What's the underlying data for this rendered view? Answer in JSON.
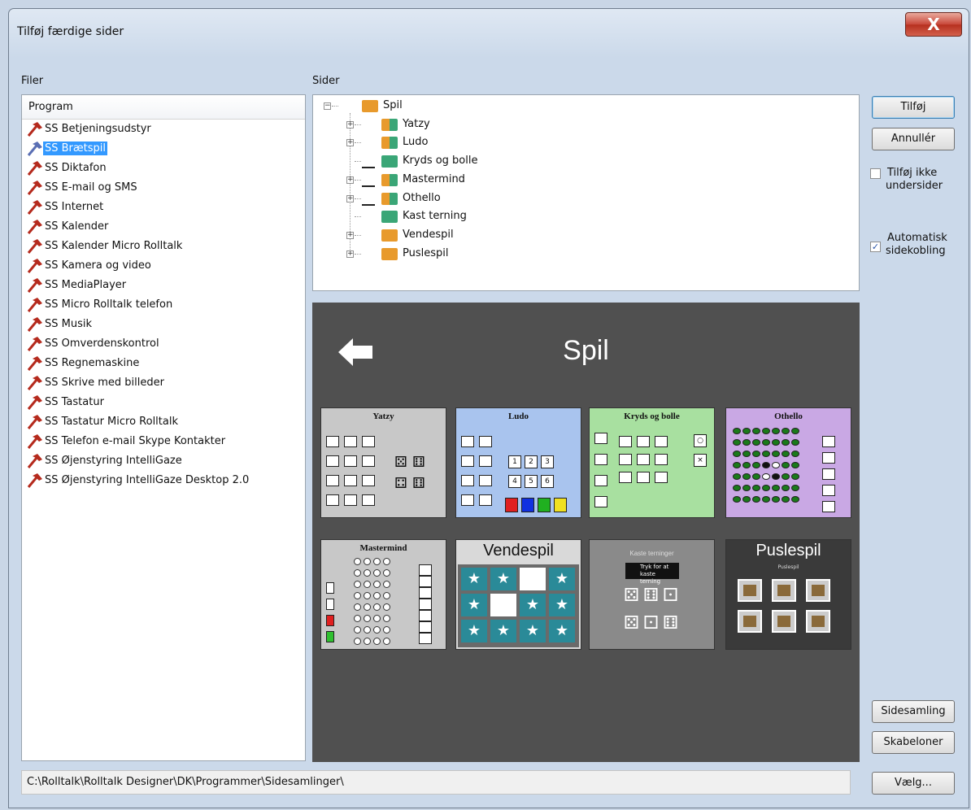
{
  "window": {
    "title": "Tilføj færdige sider",
    "close_glyph": "X"
  },
  "files": {
    "label": "Filer",
    "column_header": "Program",
    "items": [
      {
        "label": "SS Betjeningsudstyr",
        "selected": false
      },
      {
        "label": "SS Brætspil",
        "selected": true
      },
      {
        "label": "SS Diktafon",
        "selected": false
      },
      {
        "label": "SS E-mail og SMS",
        "selected": false
      },
      {
        "label": "SS Internet",
        "selected": false
      },
      {
        "label": "SS Kalender",
        "selected": false
      },
      {
        "label": "SS Kalender Micro Rolltalk",
        "selected": false
      },
      {
        "label": "SS Kamera og video",
        "selected": false
      },
      {
        "label": "SS MediaPlayer",
        "selected": false
      },
      {
        "label": "SS Micro Rolltalk telefon",
        "selected": false
      },
      {
        "label": "SS Musik",
        "selected": false
      },
      {
        "label": "SS Omverdenskontrol",
        "selected": false
      },
      {
        "label": "SS Regnemaskine",
        "selected": false
      },
      {
        "label": "SS Skrive med billeder",
        "selected": false
      },
      {
        "label": "SS Tastatur",
        "selected": false
      },
      {
        "label": "SS Tastatur Micro Rolltalk",
        "selected": false
      },
      {
        "label": "SS Telefon e-mail Skype Kontakter",
        "selected": false
      },
      {
        "label": "SS Øjenstyring IntelliGaze",
        "selected": false
      },
      {
        "label": "SS Øjenstyring IntelliGaze Desktop 2.0",
        "selected": false
      }
    ]
  },
  "pages": {
    "label": "Sider",
    "tree": {
      "root": "Spil",
      "children": [
        {
          "label": "Yatzy",
          "expandable": true
        },
        {
          "label": "Ludo",
          "expandable": true
        },
        {
          "label": "Kryds og bolle",
          "expandable": false
        },
        {
          "label": "Mastermind",
          "expandable": true
        },
        {
          "label": "Othello",
          "expandable": true
        },
        {
          "label": "Kast terning",
          "expandable": false
        },
        {
          "label": "Vendespil",
          "expandable": true
        },
        {
          "label": "Puslespil",
          "expandable": true
        }
      ]
    }
  },
  "preview": {
    "title": "Spil",
    "thumbnails": [
      {
        "title": "Yatzy",
        "bg": "#c8c8c8"
      },
      {
        "title": "Ludo",
        "bg": "#a9c4ee"
      },
      {
        "title": "Kryds og bolle",
        "bg": "#a8e0a0"
      },
      {
        "title": "Othello",
        "bg": "#c9a8e4"
      },
      {
        "title": "Mastermind",
        "bg": "#c8c8c8"
      },
      {
        "title": "Vendespil",
        "bg": "#9aa0a6"
      },
      {
        "title": "Kaste terninger",
        "bg": "#8a8a8a"
      },
      {
        "title": "Puslespil",
        "bg": "#3a3a3a"
      }
    ],
    "kaste_button_text": "Tryk for at kaste terning",
    "puslespil_sublabel": "Puslespil"
  },
  "buttons": {
    "add": "Tilføj",
    "cancel": "Annullér",
    "collection": "Sidesamling",
    "templates": "Skabeloner",
    "choose": "Vælg..."
  },
  "options": {
    "no_subpages": {
      "label_line1": "Tilføj ikke",
      "label_line2": "undersider",
      "checked": false
    },
    "auto_link": {
      "label_line1": "Automatisk",
      "label_line2": "sidekobling",
      "checked": true
    }
  },
  "path": "C:\\Rolltalk\\Rolltalk Designer\\DK\\Programmer\\Sidesamlinger\\",
  "colors": {
    "selection": "#3399ff",
    "folder_orange": "#e89a2c",
    "folder_green": "#3aa677",
    "preview_bg": "#505050"
  }
}
